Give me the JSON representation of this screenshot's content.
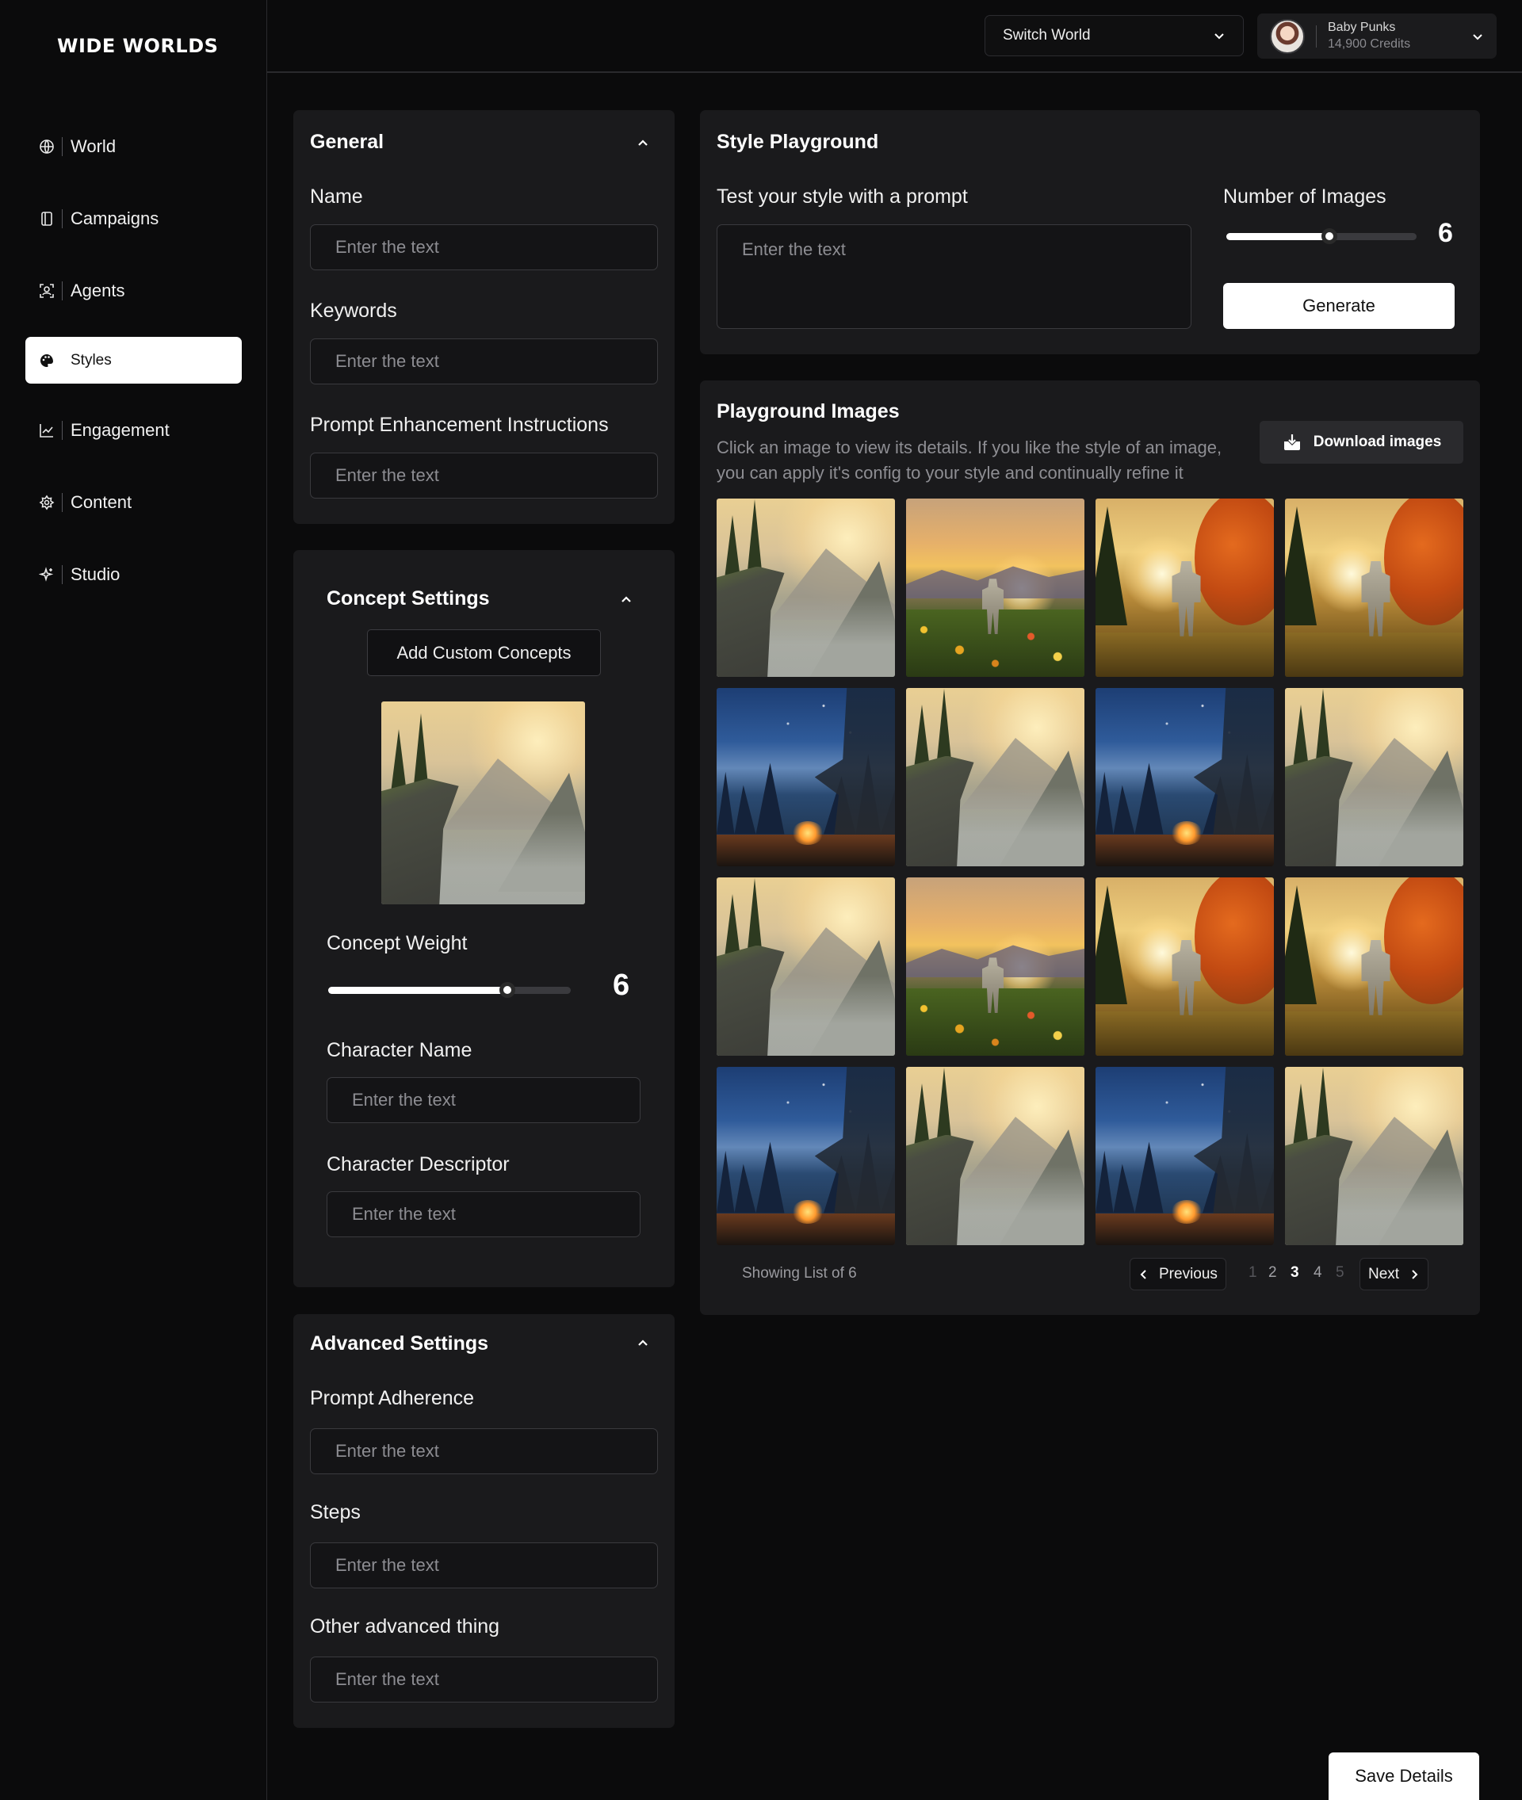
{
  "app": {
    "logo": "WIDE WORLDS"
  },
  "sidebar": {
    "items": [
      {
        "label": "World",
        "icon": "globe-icon",
        "active": false
      },
      {
        "label": "Campaigns",
        "icon": "book-icon",
        "active": false
      },
      {
        "label": "Agents",
        "icon": "agent-scan-icon",
        "active": false
      },
      {
        "label": "Styles",
        "icon": "palette-icon",
        "active": true
      },
      {
        "label": "Engagement",
        "icon": "chart-line-icon",
        "active": false
      },
      {
        "label": "Content",
        "icon": "gear-star-icon",
        "active": false
      },
      {
        "label": "Studio",
        "icon": "sparkle-icon",
        "active": false
      }
    ]
  },
  "header": {
    "switch_world": "Switch World",
    "user": {
      "name": "Baby Punks",
      "credits": "14,900 Credits"
    }
  },
  "general": {
    "title": "General",
    "name_label": "Name",
    "name_placeholder": "Enter the text",
    "keywords_label": "Keywords",
    "keywords_placeholder": "Enter the text",
    "prompt_label": "Prompt Enhancement Instructions",
    "prompt_placeholder": "Enter the text"
  },
  "concept": {
    "title": "Concept Settings",
    "add_button": "Add Custom Concepts",
    "weight_label": "Concept Weight",
    "weight_value": "6",
    "weight_fraction": 0.74,
    "char_name_label": "Character Name",
    "char_name_placeholder": "Enter the text",
    "char_desc_label": "Character Descriptor",
    "char_desc_placeholder": "Enter the text"
  },
  "advanced": {
    "title": "Advanced Settings",
    "adherence_label": "Prompt Adherence",
    "adherence_placeholder": "Enter the text",
    "steps_label": "Steps",
    "steps_placeholder": "Enter the text",
    "other_label": "Other advanced thing",
    "other_placeholder": "Enter the text"
  },
  "playground": {
    "title": "Style Playground",
    "prompt_label": "Test your style with a prompt",
    "prompt_placeholder": "Enter the text",
    "count_label": "Number of Images",
    "count_value": "6",
    "count_fraction": 0.54,
    "generate_label": "Generate"
  },
  "images": {
    "title": "Playground Images",
    "description": "Click an image to view its details. If you like the style of an image, you can apply it's config to your style and continually refine it",
    "download_label": "Download images",
    "grid": [
      [
        "cliff",
        "meadow",
        "robot",
        "robot"
      ],
      [
        "night",
        "cliff",
        "night",
        "cliff"
      ],
      [
        "cliff",
        "meadow",
        "robot",
        "robot"
      ],
      [
        "night",
        "cliff",
        "night",
        "cliff"
      ]
    ],
    "showing": "Showing List of 6",
    "previous": "Previous",
    "next": "Next",
    "pages": [
      "1",
      "2",
      "3",
      "4",
      "5"
    ],
    "current_page": "3"
  },
  "footer": {
    "save_label": "Save Details"
  }
}
